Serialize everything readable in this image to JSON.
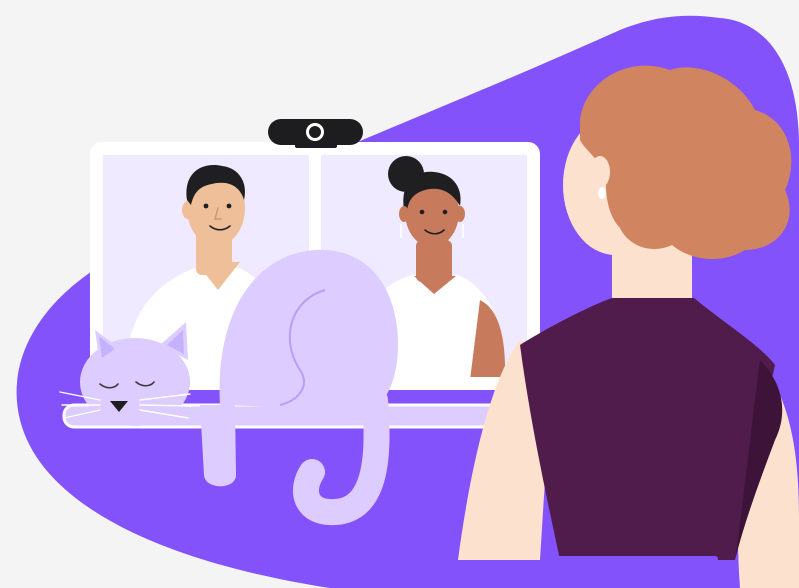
{
  "illustration": {
    "subject": "video-call-illustration",
    "participants": [
      "man-participant",
      "woman-participant"
    ],
    "viewer": "woman-with-red-hair",
    "pet": "sleeping-cat"
  },
  "colors": {
    "background": "#f4f4f5",
    "blob": "#8352fb",
    "monitor_frame": "#ffffff",
    "screen_panel": "#efeaff",
    "webcam": "#1d1d1f",
    "cat": "#dcccff",
    "cat_shade": "#c5b2ff",
    "skin_light": "#eebf99",
    "skin_dark": "#c77a5c",
    "skin_viewer": "#fde1cf",
    "hair_dark": "#1f1f22",
    "hair_red": "#d0845f",
    "shirt_white": "#ffffff",
    "top_plum": "#4f1c4b",
    "accent_stripe": "#8352fb"
  }
}
